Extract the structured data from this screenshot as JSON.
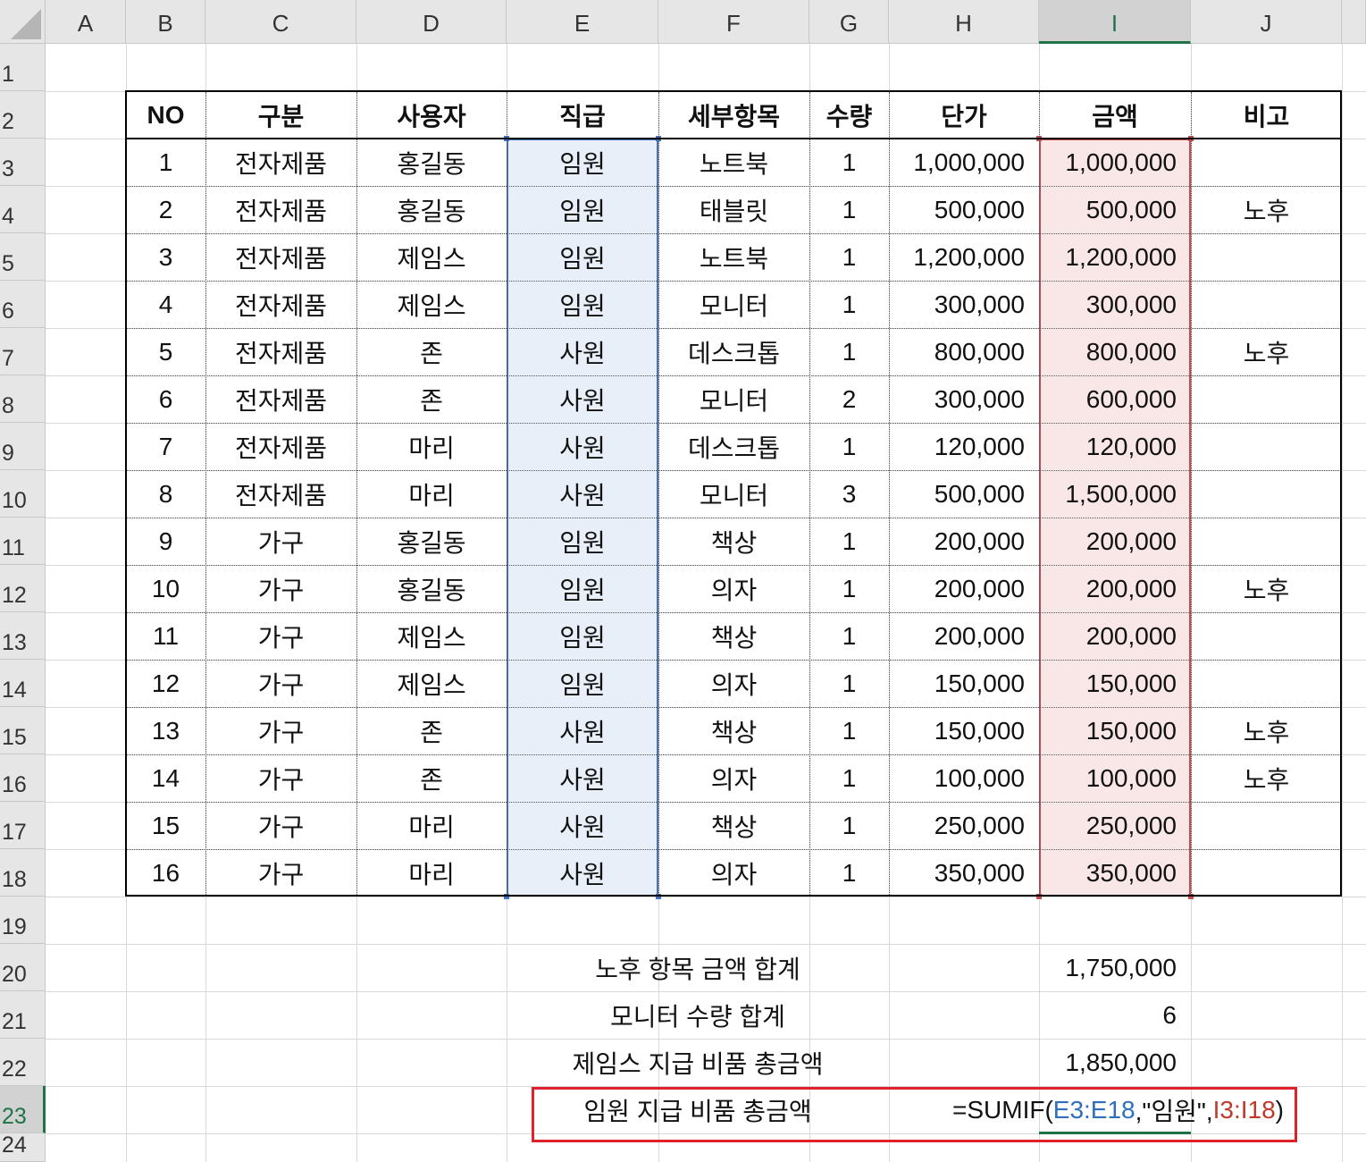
{
  "columns": [
    "A",
    "B",
    "C",
    "D",
    "E",
    "F",
    "G",
    "H",
    "I",
    "J"
  ],
  "rows": [
    "1",
    "2",
    "3",
    "4",
    "5",
    "6",
    "7",
    "8",
    "9",
    "10",
    "11",
    "12",
    "13",
    "14",
    "15",
    "16",
    "17",
    "18",
    "19",
    "20",
    "21",
    "22",
    "23",
    "24"
  ],
  "table": {
    "headers": [
      "NO",
      "구분",
      "사용자",
      "직급",
      "세부항목",
      "수량",
      "단가",
      "금액",
      "비고"
    ],
    "records": [
      [
        "1",
        "전자제품",
        "홍길동",
        "임원",
        "노트북",
        "1",
        "1,000,000",
        "1,000,000",
        ""
      ],
      [
        "2",
        "전자제품",
        "홍길동",
        "임원",
        "태블릿",
        "1",
        "500,000",
        "500,000",
        "노후"
      ],
      [
        "3",
        "전자제품",
        "제임스",
        "임원",
        "노트북",
        "1",
        "1,200,000",
        "1,200,000",
        ""
      ],
      [
        "4",
        "전자제품",
        "제임스",
        "임원",
        "모니터",
        "1",
        "300,000",
        "300,000",
        ""
      ],
      [
        "5",
        "전자제품",
        "존",
        "사원",
        "데스크톱",
        "1",
        "800,000",
        "800,000",
        "노후"
      ],
      [
        "6",
        "전자제품",
        "존",
        "사원",
        "모니터",
        "2",
        "300,000",
        "600,000",
        ""
      ],
      [
        "7",
        "전자제품",
        "마리",
        "사원",
        "데스크톱",
        "1",
        "120,000",
        "120,000",
        ""
      ],
      [
        "8",
        "전자제품",
        "마리",
        "사원",
        "모니터",
        "3",
        "500,000",
        "1,500,000",
        ""
      ],
      [
        "9",
        "가구",
        "홍길동",
        "임원",
        "책상",
        "1",
        "200,000",
        "200,000",
        ""
      ],
      [
        "10",
        "가구",
        "홍길동",
        "임원",
        "의자",
        "1",
        "200,000",
        "200,000",
        "노후"
      ],
      [
        "11",
        "가구",
        "제임스",
        "임원",
        "책상",
        "1",
        "200,000",
        "200,000",
        ""
      ],
      [
        "12",
        "가구",
        "제임스",
        "임원",
        "의자",
        "1",
        "150,000",
        "150,000",
        ""
      ],
      [
        "13",
        "가구",
        "존",
        "사원",
        "책상",
        "1",
        "150,000",
        "150,000",
        "노후"
      ],
      [
        "14",
        "가구",
        "존",
        "사원",
        "의자",
        "1",
        "100,000",
        "100,000",
        "노후"
      ],
      [
        "15",
        "가구",
        "마리",
        "사원",
        "책상",
        "1",
        "250,000",
        "250,000",
        ""
      ],
      [
        "16",
        "가구",
        "마리",
        "사원",
        "의자",
        "1",
        "350,000",
        "350,000",
        ""
      ]
    ]
  },
  "summary": [
    {
      "label": "노후 항목 금액 합계",
      "value": "1,750,000"
    },
    {
      "label": "모니터 수량 합계",
      "value": "6"
    },
    {
      "label": "제임스 지급 비품 총금액",
      "value": "1,850,000"
    }
  ],
  "formula_row": {
    "label": "임원 지급 비품 총금액",
    "prefix": "=SUMIF(",
    "ref1": "E3:E18",
    "mid": ",\"임원\",",
    "ref2": "I3:I18",
    "suffix": ")"
  },
  "colors": {
    "selection_green": "#217346",
    "range_blue": "#4472c4",
    "range_red": "#c0504d",
    "highlight_box": "#e0202a"
  }
}
